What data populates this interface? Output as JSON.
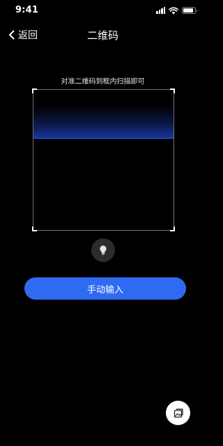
{
  "status_bar": {
    "time": "9:41",
    "icons": [
      "signal-icon",
      "wifi-icon",
      "battery-icon"
    ]
  },
  "nav": {
    "back_label": "返回",
    "back_icon": "chevron-left-icon",
    "title": "二维码"
  },
  "scanner": {
    "hint": "对准二维码到框内扫描即可",
    "accent_color": "#2f5fe0"
  },
  "torch": {
    "icon": "flashlight-icon"
  },
  "manual_input": {
    "label": "手动输入",
    "color": "#2f6bf2"
  },
  "album": {
    "icon": "image-icon"
  }
}
